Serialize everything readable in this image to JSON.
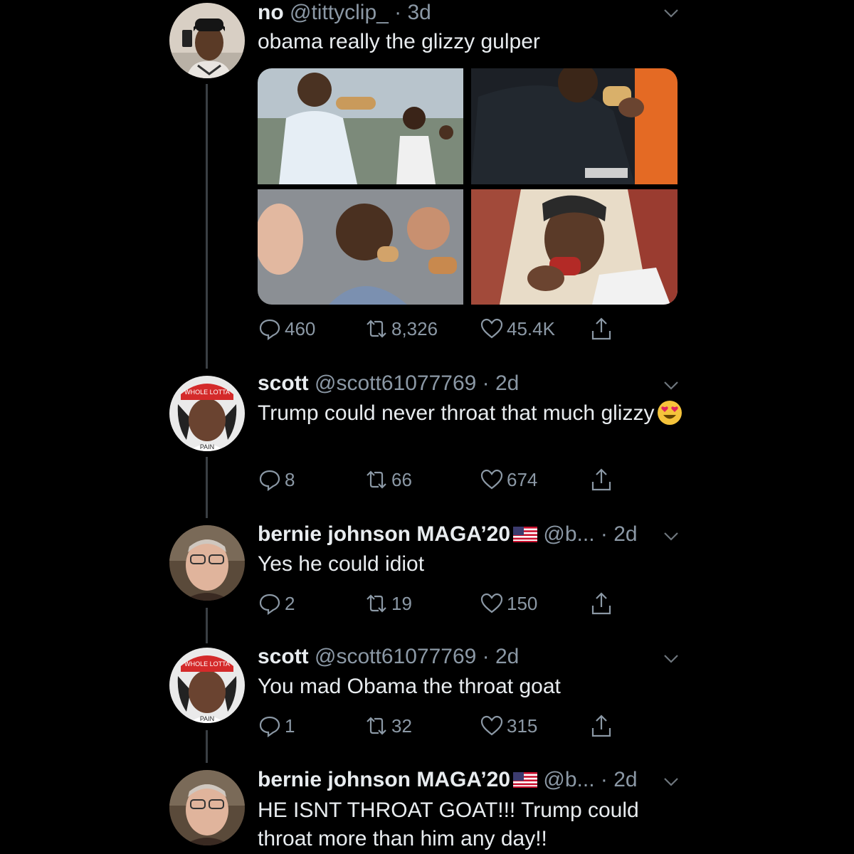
{
  "tweets": [
    {
      "name": "no",
      "handle": "@tittyclip_",
      "time": "3d",
      "text": "obama really the glizzy gulper",
      "replies": "460",
      "retweets": "8,326",
      "likes": "45.4K",
      "media_count": 4
    },
    {
      "name": "scott",
      "handle": "@scott61077769",
      "time": "2d",
      "text": "Trump could never throat that much glizzy",
      "emoji": "heart-eyes-emoji",
      "replies": "8",
      "retweets": "66",
      "likes": "674",
      "avatar_cap_text": "WHOLE LOTTA",
      "avatar_shirt_text": "PAIN"
    },
    {
      "name": "bernie johnson MAGA’20",
      "handle": "@b...",
      "time": "2d",
      "text": "Yes he could idiot",
      "replies": "2",
      "retweets": "19",
      "likes": "150"
    },
    {
      "name": "scott",
      "handle": "@scott61077769",
      "time": "2d",
      "text": "You mad Obama the throat goat",
      "replies": "1",
      "retweets": "32",
      "likes": "315",
      "avatar_cap_text": "WHOLE LOTTA",
      "avatar_shirt_text": "PAIN"
    },
    {
      "name": "bernie johnson MAGA’20",
      "handle": "@b...",
      "time": "2d",
      "text_line1": "HE ISNT THROAT GOAT!!! Trump could",
      "text_line2": "throat more than him any day!!"
    }
  ],
  "separator": " · ",
  "icons": {
    "reply": "reply-icon",
    "retweet": "retweet-icon",
    "like": "like-icon",
    "share": "share-icon",
    "more": "chevron-down-icon",
    "flag": "us-flag-icon"
  },
  "colors": {
    "background": "#000000",
    "text": "#e8ecef",
    "muted": "#8b98a5",
    "thread_line": "#3a3f44"
  }
}
